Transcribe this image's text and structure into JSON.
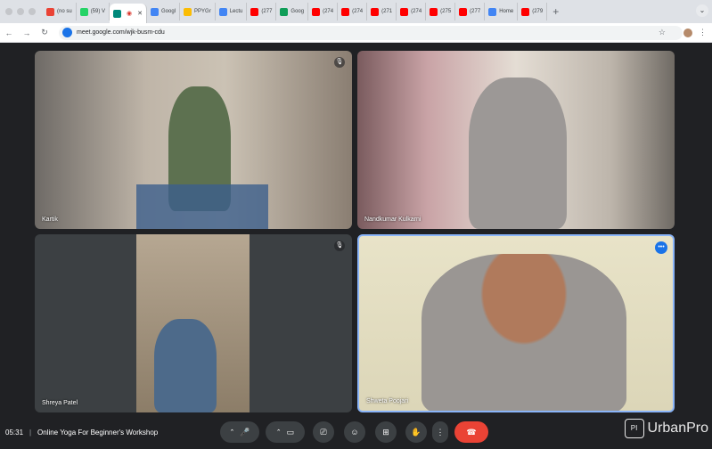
{
  "browser": {
    "tabs": [
      {
        "label": "(no su",
        "icon": "gmail-icon",
        "color": "#ea4335"
      },
      {
        "label": "(59) V",
        "icon": "whatsapp-icon",
        "color": "#25d366"
      },
      {
        "label": "",
        "icon": "meet-icon",
        "color": "#00897b",
        "active": true
      },
      {
        "label": "Googl",
        "icon": "google-icon",
        "color": "#4285f4"
      },
      {
        "label": "PPYGr",
        "icon": "drive-icon",
        "color": "#fbbc04"
      },
      {
        "label": "Lectu",
        "icon": "docs-icon",
        "color": "#4285f4"
      },
      {
        "label": "(277",
        "icon": "youtube-icon",
        "color": "#ff0000"
      },
      {
        "label": "Goog",
        "icon": "drive-icon",
        "color": "#0f9d58"
      },
      {
        "label": "(274",
        "icon": "youtube-icon",
        "color": "#ff0000"
      },
      {
        "label": "(274",
        "icon": "youtube-icon",
        "color": "#ff0000"
      },
      {
        "label": "(271",
        "icon": "youtube-icon",
        "color": "#ff0000"
      },
      {
        "label": "(274",
        "icon": "youtube-icon",
        "color": "#ff0000"
      },
      {
        "label": "(275",
        "icon": "youtube-icon",
        "color": "#ff0000"
      },
      {
        "label": "(277",
        "icon": "youtube-icon",
        "color": "#ff0000"
      },
      {
        "label": "Home",
        "icon": "google-icon",
        "color": "#4285f4"
      },
      {
        "label": "(279",
        "icon": "youtube-icon",
        "color": "#ff0000"
      }
    ],
    "new_tab": "+",
    "url": "meet.google.com/wjk-busm-cdu"
  },
  "participants": [
    {
      "name": "Kartik",
      "muted": true
    },
    {
      "name": "Nandkumar Kulkarni",
      "muted": false
    },
    {
      "name": "Shreya Patel",
      "muted": true
    },
    {
      "name": "Shweta Poojari",
      "speaking": true
    }
  ],
  "meeting": {
    "time": "05:31",
    "separator": "|",
    "title": "Online Yoga For Beginner's Workshop"
  },
  "watermark": {
    "box": "PI",
    "text": "UrbanPro"
  }
}
